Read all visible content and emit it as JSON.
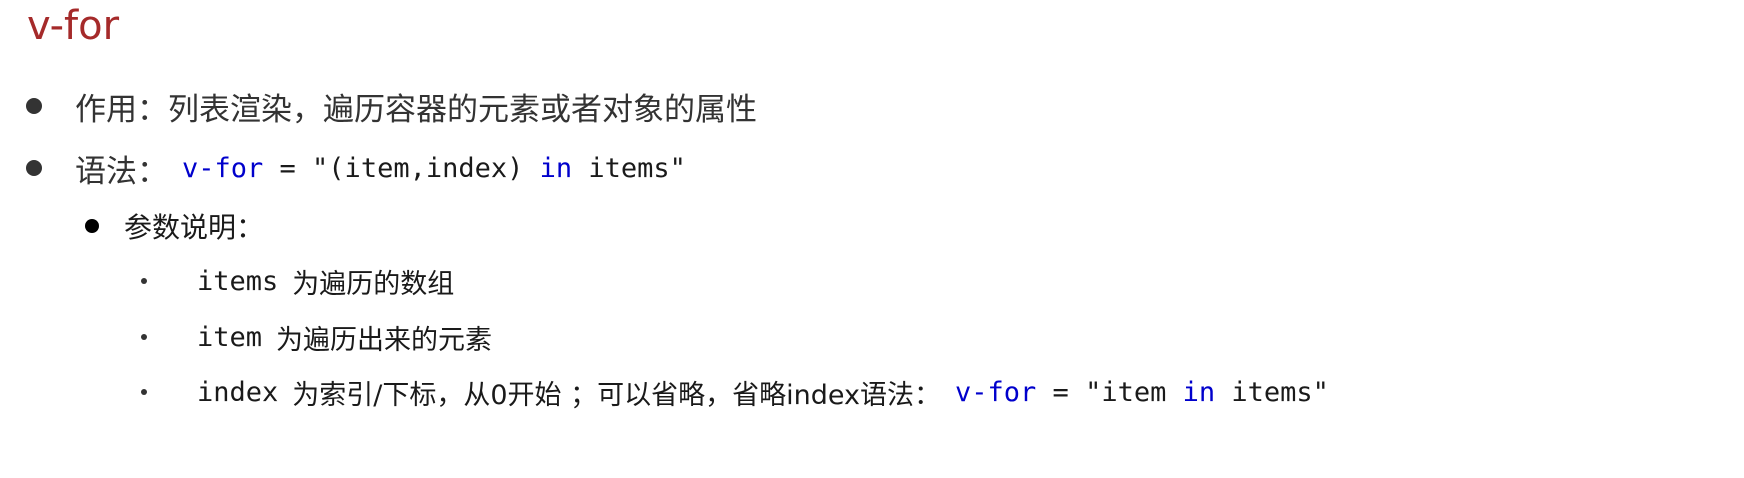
{
  "title": "v-for",
  "bullets": {
    "effect": {
      "text": "作用：列表渲染，遍历容器的元素或者对象的属性"
    },
    "syntax": {
      "label": "语法：",
      "code_kw": "v-for",
      "code_rest_1": " = \"(item,index) ",
      "code_kw2": "in",
      "code_rest_2": " items\""
    },
    "params": {
      "label": "参数说明："
    },
    "items": {
      "code": "items",
      "desc": "为遍历的数组"
    },
    "item": {
      "code": "item",
      "desc": "为遍历出来的元素"
    },
    "index": {
      "code": "index",
      "desc_1": "为索引/下标，从0开始 ；可以省略，省略index语法：",
      "code_kw": "v-for",
      "code_rest_1": " = \"item ",
      "code_kw2": "in",
      "code_rest_2": " items\""
    }
  },
  "colors": {
    "title": "#a52a2a",
    "keyword": "#0000cc",
    "text": "#333333"
  }
}
